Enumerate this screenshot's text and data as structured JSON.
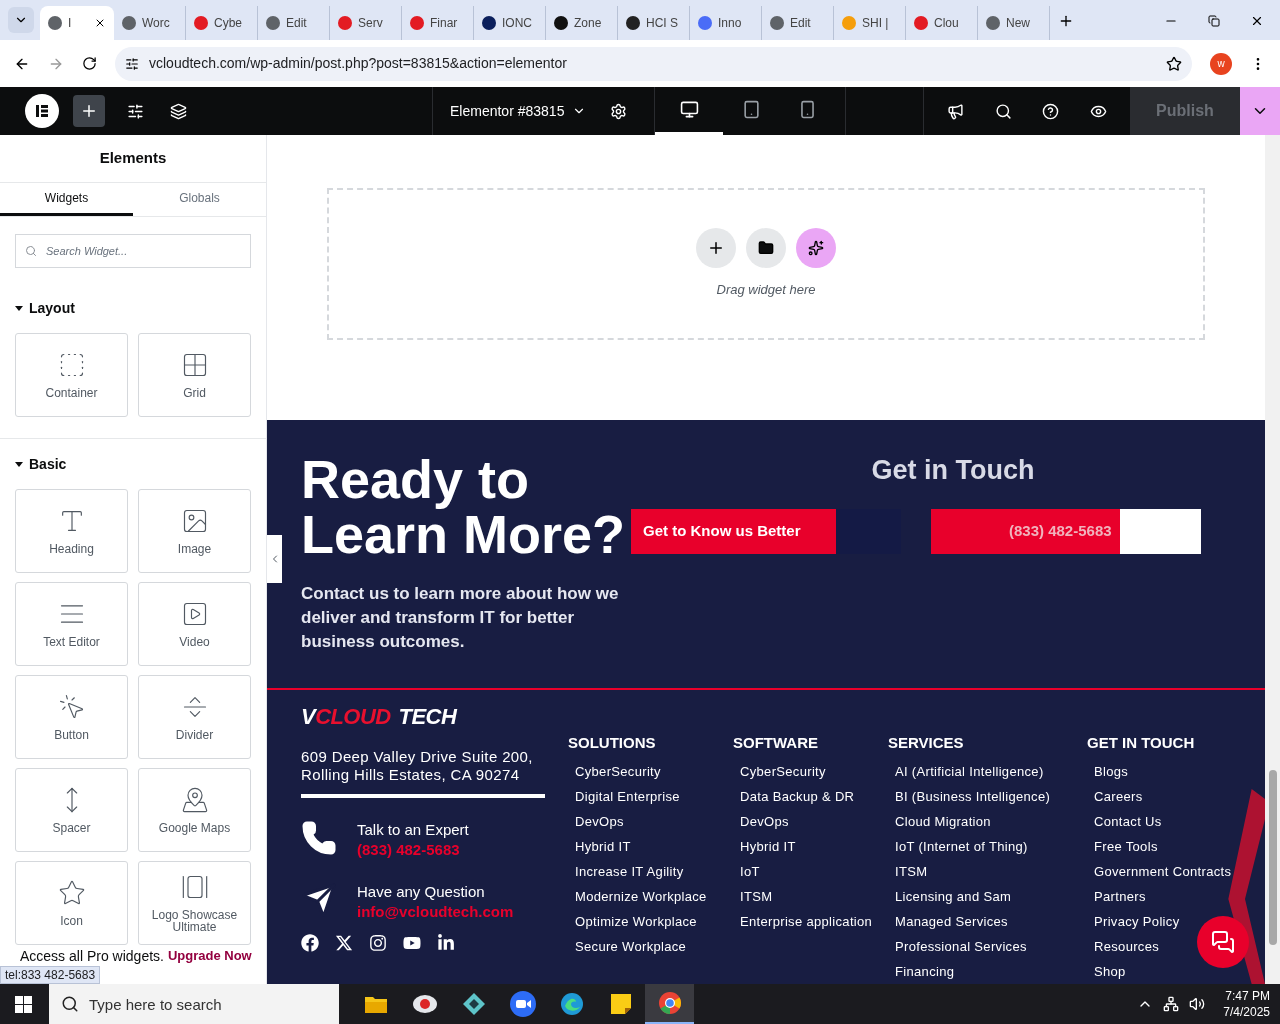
{
  "browser": {
    "tabs": [
      {
        "title": "I",
        "selected": true,
        "color": "#5f6368"
      },
      {
        "title": "Worc",
        "selected": false,
        "color": "#5f6368"
      },
      {
        "title": "Cybe",
        "selected": false,
        "color": "#e31b23"
      },
      {
        "title": "Edit",
        "selected": false,
        "color": "#5f6368"
      },
      {
        "title": "Serv",
        "selected": false,
        "color": "#e31b23"
      },
      {
        "title": "Finar",
        "selected": false,
        "color": "#e31b23"
      },
      {
        "title": "IONC",
        "selected": false,
        "color": "#0b1f5c"
      },
      {
        "title": "Zone",
        "selected": false,
        "color": "#111111"
      },
      {
        "title": "HCI S",
        "selected": false,
        "color": "#222222"
      },
      {
        "title": "Inno",
        "selected": false,
        "color": "#4a6cf7"
      },
      {
        "title": "Edit",
        "selected": false,
        "color": "#5f6368"
      },
      {
        "title": "SHI |",
        "selected": false,
        "color": "#f59e0b"
      },
      {
        "title": "Clou",
        "selected": false,
        "color": "#e31b23"
      },
      {
        "title": "New",
        "selected": false,
        "color": "#5f6368"
      }
    ],
    "url": "vcloudtech.com/wp-admin/post.php?post=83815&action=elementor",
    "profile": "w"
  },
  "editor_bar": {
    "document": "Elementor #83815",
    "devices": [
      {
        "kind": "desktop",
        "selected": true
      },
      {
        "kind": "tablet",
        "selected": false
      },
      {
        "kind": "mobile",
        "selected": false
      }
    ],
    "publish": {
      "label": "Publish",
      "disabled": true
    }
  },
  "panel": {
    "title": "Elements",
    "tabs": [
      {
        "label": "Widgets",
        "selected": true
      },
      {
        "label": "Globals",
        "selected": false
      }
    ],
    "search": {
      "placeholder": "Search Widget..."
    },
    "sections": [
      {
        "title": "Layout",
        "expanded": true,
        "widgets": [
          {
            "label": "Container",
            "kind": "container"
          },
          {
            "label": "Grid",
            "kind": "grid"
          }
        ]
      },
      {
        "title": "Basic",
        "expanded": true,
        "widgets": [
          {
            "label": "Heading",
            "kind": "heading"
          },
          {
            "label": "Image",
            "kind": "image"
          },
          {
            "label": "Text Editor",
            "kind": "text"
          },
          {
            "label": "Video",
            "kind": "video"
          },
          {
            "label": "Button",
            "kind": "button"
          },
          {
            "label": "Divider",
            "kind": "divider"
          },
          {
            "label": "Spacer",
            "kind": "spacer"
          },
          {
            "label": "Google Maps",
            "kind": "map"
          },
          {
            "label": "Icon",
            "kind": "icon"
          },
          {
            "label": "Logo Showcase Ultimate",
            "kind": "logos"
          }
        ]
      }
    ],
    "promo": {
      "text": "Access all Pro widgets.",
      "link": "Upgrade Now"
    }
  },
  "status_url": "tel:833 482-5683",
  "canvas": {
    "dropzone": {
      "hint": "Drag widget here"
    },
    "cta": {
      "heading": "Ready to Learn More?",
      "text": "Contact us to learn more about how we deliver and transform IT for better business outcomes.",
      "side_heading": "Get in Touch",
      "buttons": [
        {
          "label": "Get to Know us Better",
          "kind": "dark"
        },
        {
          "label": "(833) 482-5683",
          "kind": "light"
        }
      ]
    },
    "footer": {
      "logo": [
        {
          "text": "V",
          "color": "#ffffff"
        },
        {
          "text": "CLOUD",
          "color": "#e8102e"
        },
        {
          "text": "TECH",
          "color": "#ffffff"
        }
      ],
      "address": "609 Deep Valley Drive Suite 200, Rolling Hills Estates, CA 90274",
      "contacts": [
        {
          "kind": "phone",
          "label": "Talk to an Expert",
          "value": "(833) 482-5683"
        },
        {
          "kind": "mail",
          "label": "Have any Question",
          "value": "info@vcloudtech.com"
        }
      ],
      "socials": [
        {
          "kind": "facebook"
        },
        {
          "kind": "x"
        },
        {
          "kind": "instagram"
        },
        {
          "kind": "youtube"
        },
        {
          "kind": "linkedin"
        }
      ],
      "columns": [
        {
          "title": "SOLUTIONS",
          "links": [
            "CyberSecurity",
            "Digital Enterprise",
            "DevOps",
            "Hybrid IT",
            "Increase IT Agility",
            "Modernize Workplace",
            "Optimize Workplace",
            "Secure Workplace"
          ]
        },
        {
          "title": "SOFTWARE",
          "links": [
            "CyberSecurity",
            "Data Backup & DR",
            "DevOps",
            "Hybrid IT",
            "IoT",
            "ITSM",
            "Enterprise application"
          ]
        },
        {
          "title": "SERVICES",
          "links": [
            "AI (Artificial Intelligence)",
            "BI (Business Intelligence)",
            "Cloud Migration",
            "IoT (Internet of Thing)",
            "ITSM",
            "Licensing and Sam",
            "Managed Services",
            "Professional Services",
            "Financing"
          ]
        },
        {
          "title": "GET IN TOUCH",
          "links": [
            "Blogs",
            "Careers",
            "Contact Us",
            "Free Tools",
            "Government Contracts",
            "Partners",
            "Privacy Policy",
            "Resources",
            "Shop"
          ]
        }
      ]
    }
  },
  "taskbar": {
    "search": {
      "placeholder": "Type here to search"
    },
    "apps": [
      {
        "kind": "explorer",
        "selected": false
      },
      {
        "kind": "chat",
        "selected": false
      },
      {
        "kind": "diamond",
        "selected": false
      },
      {
        "kind": "zoom",
        "selected": false
      },
      {
        "kind": "edge",
        "selected": false
      },
      {
        "kind": "notes",
        "selected": false
      },
      {
        "kind": "chrome",
        "selected": true
      }
    ],
    "time": "7:47 PM",
    "date": "7/4/2025"
  }
}
